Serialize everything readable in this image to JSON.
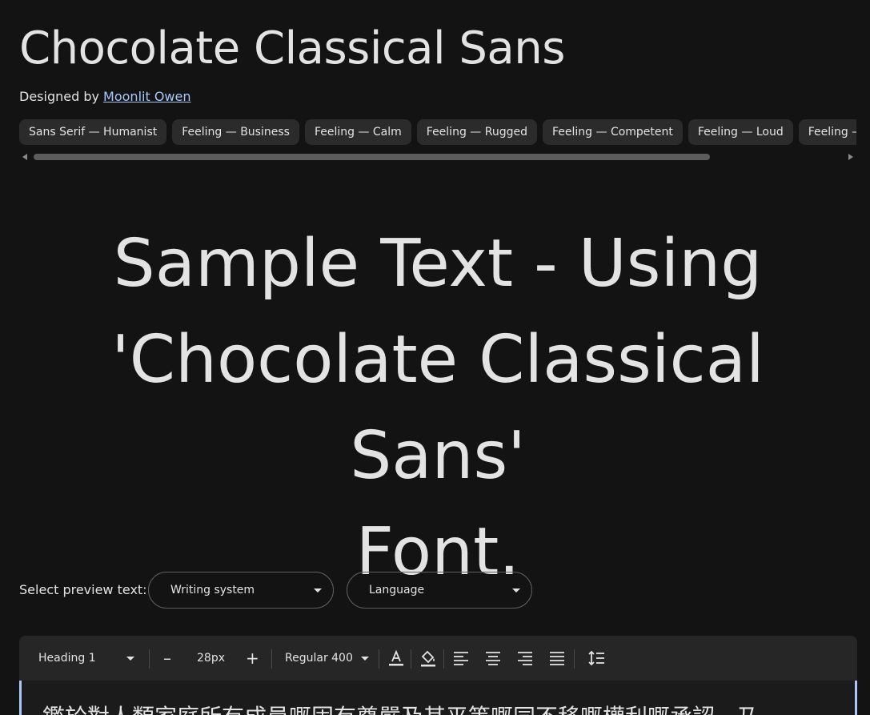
{
  "font": {
    "title": "Chocolate Classical Sans",
    "designed_by_label": "Designed by",
    "designer_name": "Moonlit Owen"
  },
  "tags": [
    "Sans Serif — Humanist",
    "Feeling — Business",
    "Feeling — Calm",
    "Feeling — Rugged",
    "Feeling — Competent",
    "Feeling — Loud",
    "Feeling — S"
  ],
  "sample": {
    "line1": "Sample Text - Using",
    "line2": "'Chocolate Classical Sans'",
    "line3": "Font."
  },
  "preview": {
    "label": "Select preview text:",
    "writing_system": "Writing system",
    "language": "Language"
  },
  "toolbar": {
    "style": "Heading 1",
    "minus": "–",
    "size": "28px",
    "plus": "+",
    "weight": "Regular 400"
  },
  "editor": {
    "text": "鑑於對人類家庭所有成員嘅固有尊嚴及其平等嘅同不移嘅權利嘅承認，乃"
  },
  "colors": {
    "background": "#131313",
    "chip": "#2b2b2b",
    "link": "#a8c7fa",
    "toolbar": "#262626"
  }
}
